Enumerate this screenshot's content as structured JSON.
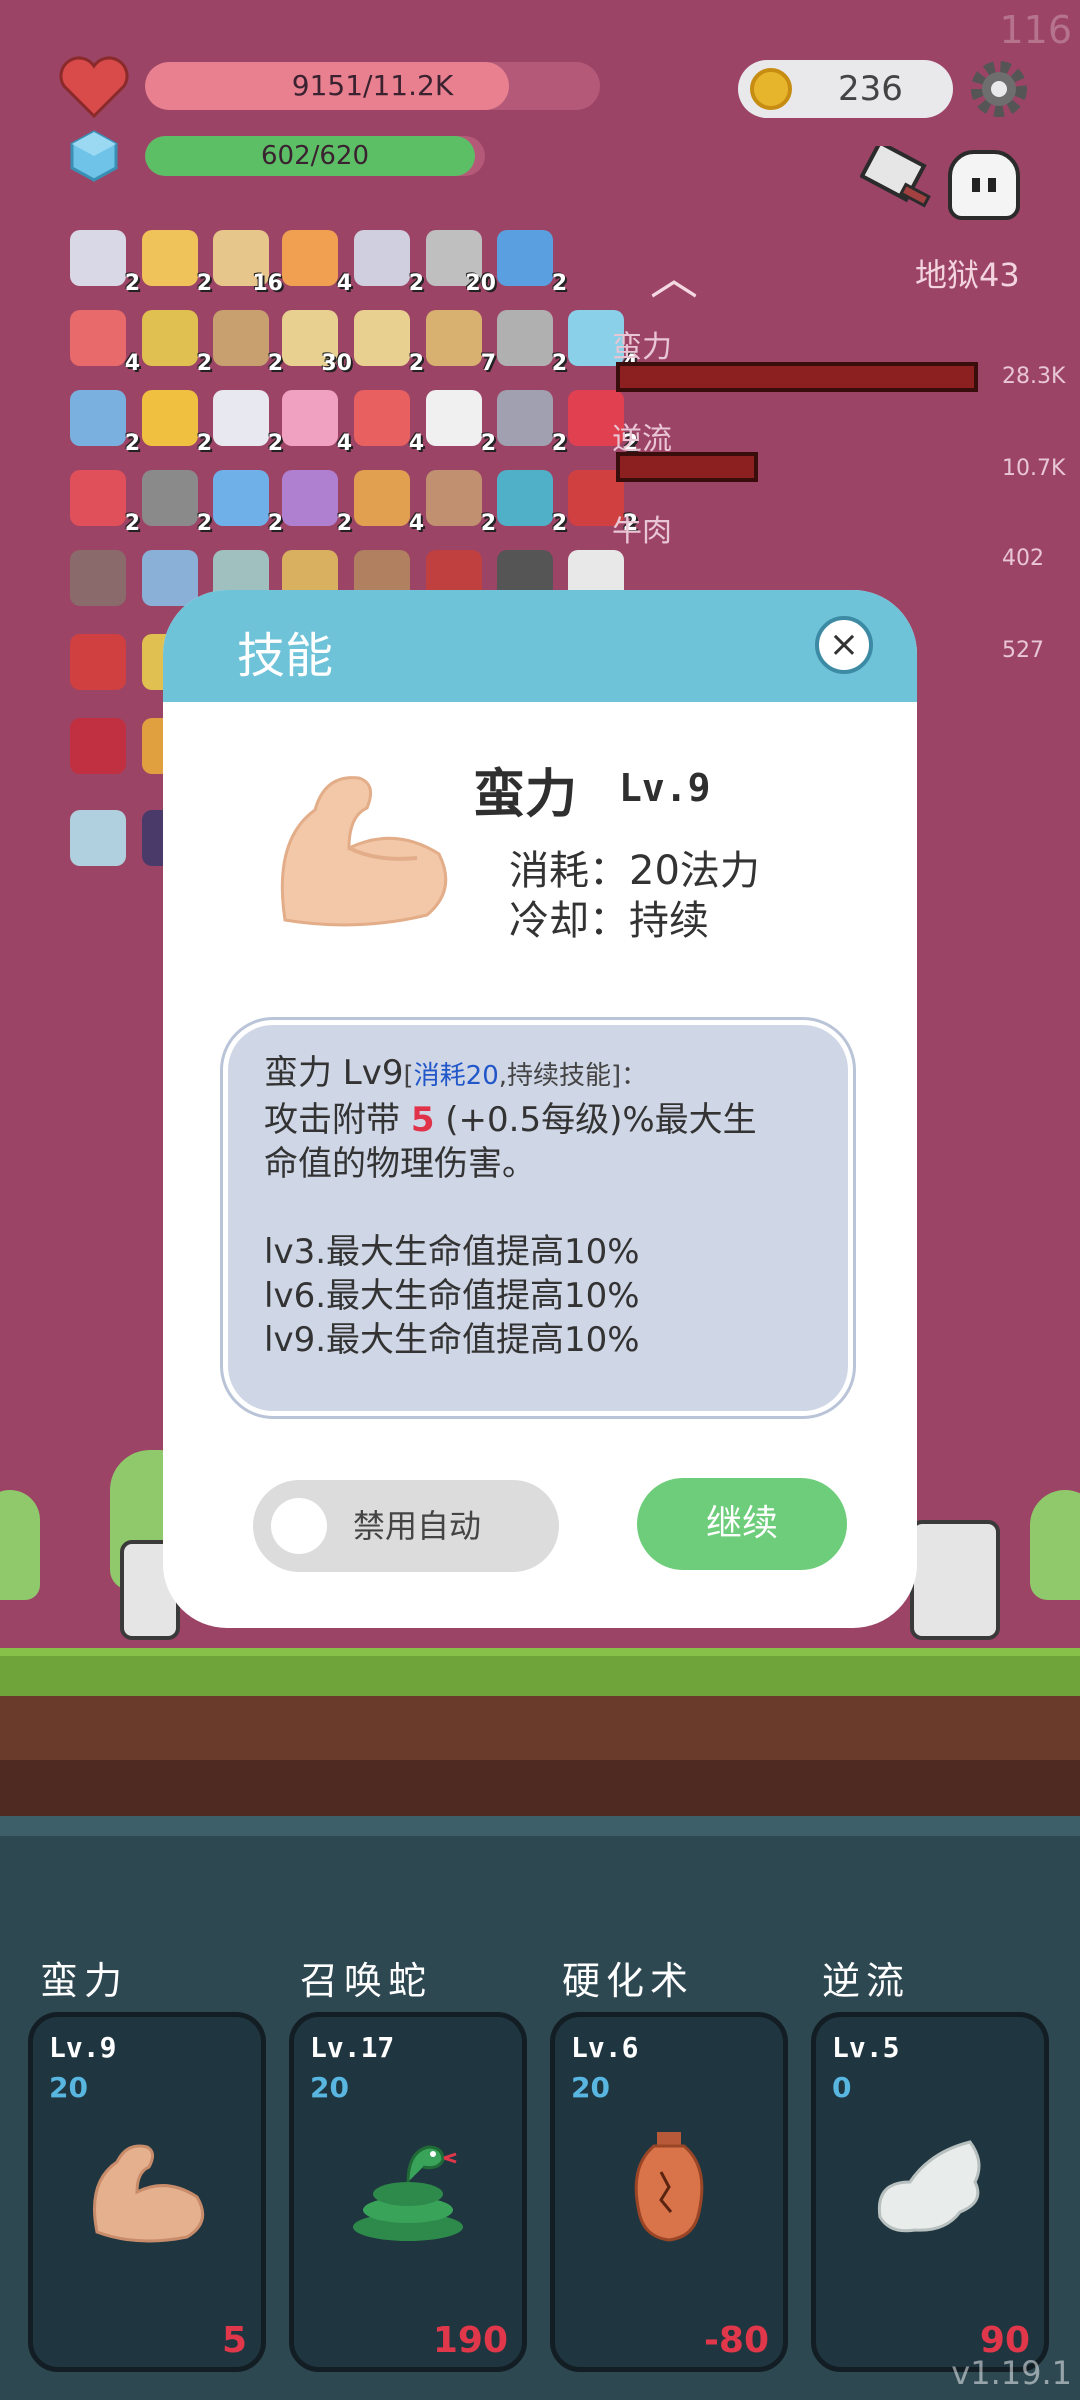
{
  "hud": {
    "hp_text": "9151/11.2K",
    "hp_fraction": 0.8,
    "mp_text": "602/620",
    "mp_fraction": 0.97,
    "coins": "236",
    "fps": "116",
    "zone": "地狱43",
    "colors": {
      "hp": "#e8808f",
      "mp": "#5cbf66",
      "bg": "#9c4466"
    }
  },
  "inventory": {
    "counts": [
      "2",
      "2",
      "16",
      "4",
      "2",
      "20",
      "2",
      "4",
      "2",
      "2",
      "30",
      "2",
      "7",
      "2",
      "4",
      "2",
      "2",
      "2",
      "4",
      "4",
      "2",
      "2",
      "2",
      "2",
      "2",
      "2",
      "2",
      "4",
      "2",
      "2",
      "2"
    ]
  },
  "stats": [
    {
      "label": "蛮力",
      "value": "28.3K",
      "fraction": 0.9
    },
    {
      "label": "逆流",
      "value": "10.7K",
      "fraction": 0.36
    },
    {
      "label": "牛肉",
      "value": "402",
      "fraction": 0
    },
    {
      "label": "",
      "value": "527",
      "fraction": 0
    }
  ],
  "modal": {
    "title": "技能",
    "close_label": "×",
    "skill_name": "蛮力",
    "skill_level": "Lv.9",
    "cost_line": "消耗：20法力",
    "cooldown_line": "冷却：持续",
    "desc_head": "蛮力 Lv9",
    "desc_bracket_open": "[",
    "desc_bracket_blue": "消耗20",
    "desc_bracket_rest": ",持续技能]：",
    "desc_line1_a": "攻击附带 ",
    "desc_line1_num": "5",
    "desc_line1_b": " (+0.5每级)%最大生",
    "desc_line2": "命值的物理伤害。",
    "perk1": "lv3.最大生命值提高10%",
    "perk2": "lv6.最大生命值提高10%",
    "perk3": "lv9.最大生命值提高10%",
    "toggle_label": "禁用自动",
    "continue_label": "继续"
  },
  "skills": [
    {
      "name": "蛮力",
      "level": "Lv.9",
      "cost": "20",
      "value": "5",
      "icon": "muscle-icon"
    },
    {
      "name": "召唤蛇",
      "level": "Lv.17",
      "cost": "20",
      "value": "190",
      "icon": "snake-icon"
    },
    {
      "name": "硬化术",
      "level": "Lv.6",
      "cost": "20",
      "value": "-80",
      "icon": "vase-icon"
    },
    {
      "name": "逆流",
      "level": "Lv.5",
      "cost": "0",
      "value": "90",
      "icon": "wing-icon"
    }
  ],
  "version": "v1.19.1"
}
